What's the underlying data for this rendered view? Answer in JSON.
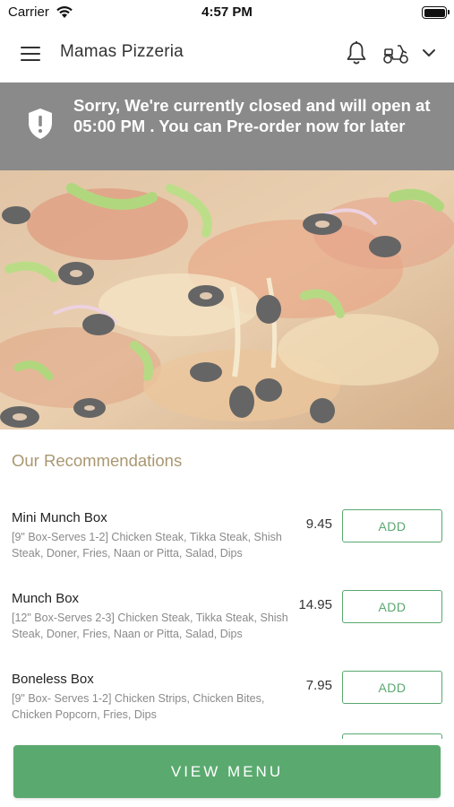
{
  "status_bar": {
    "carrier": "Carrier",
    "time": "4:57 PM"
  },
  "header": {
    "title": "Mamas Pizzeria",
    "icons": [
      "menu-icon",
      "bell-icon",
      "scooter-icon",
      "chevron-down-icon"
    ]
  },
  "banner": {
    "icon": "shield-alert-icon",
    "message": "Sorry, We're currently closed and will open at 05:00 PM . You can Pre-order now for later",
    "background": "#8a8a8a"
  },
  "hero": {
    "image": "pizza-photo"
  },
  "recommendations": {
    "title": "Our Recommendations",
    "title_color": "#a99770",
    "items": [
      {
        "name": "Mini Munch Box",
        "description": "[9\" Box-Serves 1-2] Chicken Steak, Tikka Steak, Shish Steak, Doner, Fries, Naan or Pitta, Salad, Dips",
        "price": "9.45",
        "button": "ADD"
      },
      {
        "name": "Munch Box",
        "description": "[12\" Box-Serves 2-3] Chicken Steak, Tikka Steak, Shish Steak, Doner, Fries, Naan or Pitta, Salad, Dips",
        "price": "14.95",
        "button": "ADD"
      },
      {
        "name": "Boneless Box",
        "description": "[9\" Box- Serves 1-2] Chicken Strips, Chicken Bites, Chicken Popcorn, Fries, Dips",
        "price": "7.95",
        "button": "ADD"
      }
    ]
  },
  "footer": {
    "view_menu_label": "VIEW MENU",
    "accent": "#5aaa6f"
  }
}
